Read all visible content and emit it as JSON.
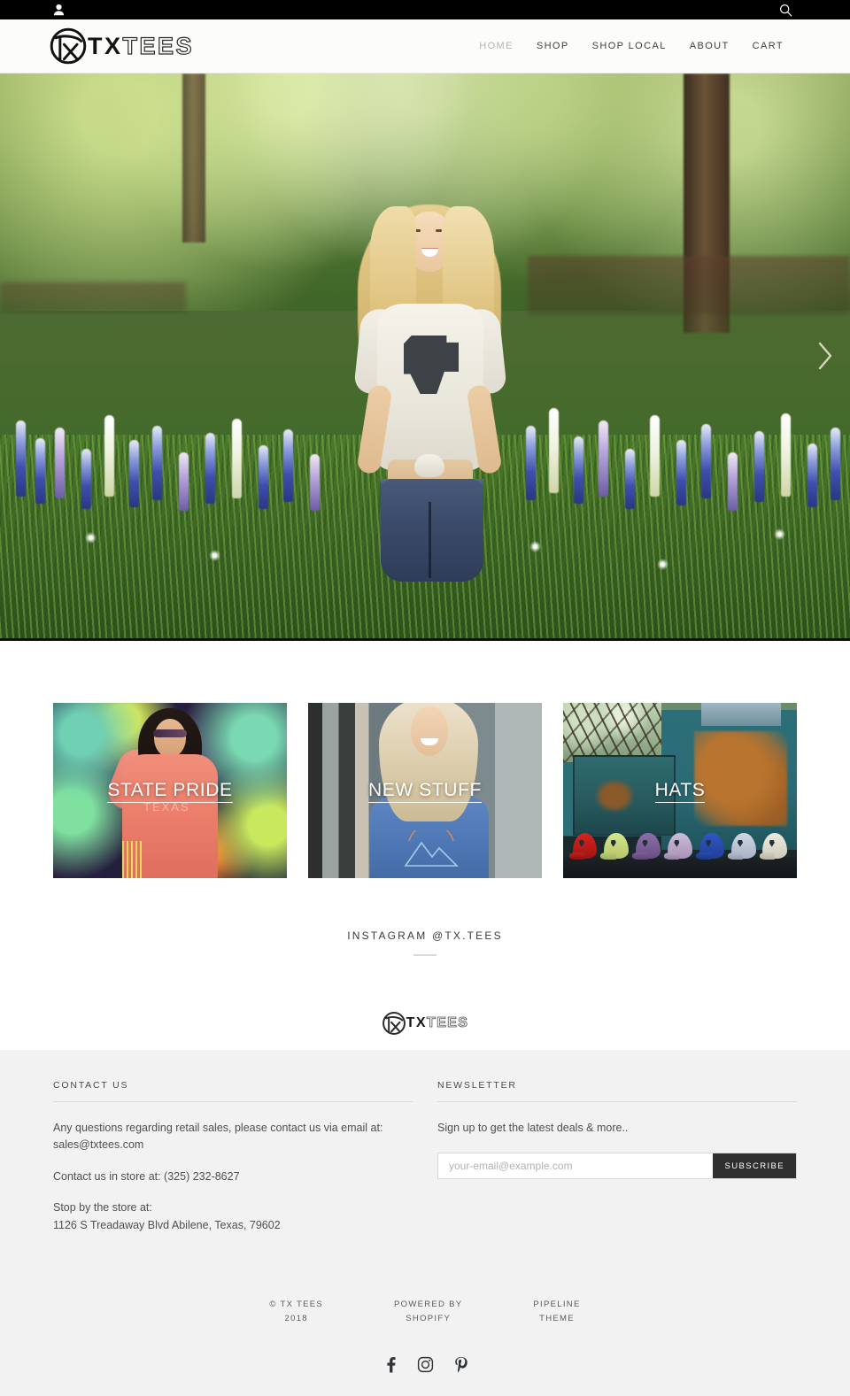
{
  "topbar": {
    "account_icon": "user-icon",
    "search_icon": "search-icon"
  },
  "brand": {
    "name_bold": "TX",
    "name_outline": "TEES",
    "mark": "tx-circle-monogram-logo"
  },
  "nav": {
    "items": [
      {
        "label": "HOME",
        "active": true
      },
      {
        "label": "SHOP",
        "active": false
      },
      {
        "label": "SHOP LOCAL",
        "active": false
      },
      {
        "label": "ABOUT",
        "active": false
      },
      {
        "label": "CART",
        "active": false
      }
    ]
  },
  "hero": {
    "alt": "Woman in TX Tees shirt standing in a bluebonnet wildflower field",
    "next_arrow_icon": "chevron-right-icon"
  },
  "collections": {
    "tiles": [
      {
        "label": "STATE PRIDE",
        "image_alt": "Woman in coral sweatshirt in front of colorful chalk mural"
      },
      {
        "label": "NEW STUFF",
        "image_alt": "Blonde woman in blue mountain graphic tee in front of storefront"
      },
      {
        "label": "HATS",
        "image_alt": "Row of colorful caps lined up on a rusty teal vintage truck"
      }
    ]
  },
  "instagram": {
    "heading": "INSTAGRAM @TX.TEES"
  },
  "footer": {
    "contact": {
      "heading": "CONTACT US",
      "line1": "Any questions regarding retail sales, please contact us via email at: sales@txtees.com",
      "line2": "Contact us in store at: (325) 232-8627",
      "line3a": "Stop by the store at:",
      "line3b": "1126 S Treadaway Blvd Abilene, Texas, 79602"
    },
    "newsletter": {
      "heading": "NEWSLETTER",
      "description": "Sign up to get the latest deals & more..",
      "placeholder": "your-email@example.com",
      "submit_label": "SUBSCRIBE"
    },
    "credits": [
      {
        "line1": "© TX TEES",
        "line2": "2018"
      },
      {
        "line1": "POWERED BY",
        "line2": "SHOPIFY"
      },
      {
        "line1": "PIPELINE",
        "line2": "THEME"
      }
    ],
    "social": [
      {
        "name": "facebook-icon"
      },
      {
        "name": "instagram-icon"
      },
      {
        "name": "pinterest-icon"
      }
    ]
  },
  "colors": {
    "topbar_bg": "#000000",
    "header_bg": "#fcfcfa",
    "footer_bg": "#f2f2f2",
    "button_dark": "#2f2f2f",
    "nav_text": "#3f3f3f",
    "nav_active": "#b2b2b2"
  }
}
